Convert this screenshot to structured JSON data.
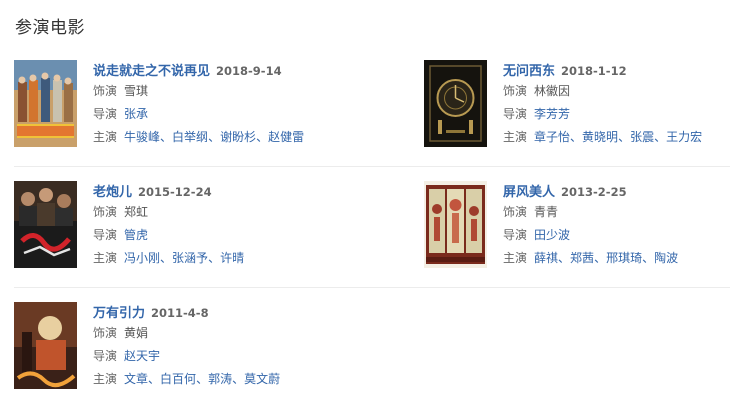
{
  "section_title": "参演电影",
  "labels": {
    "role": "饰演",
    "director": "导演",
    "cast": "主演",
    "separator": "、"
  },
  "movies": [
    {
      "title": "说走就走之不说再见",
      "date": "2018-9-14",
      "role": "雪琪",
      "director": "张承",
      "cast": [
        "牛骏峰",
        "白举纲",
        "谢盼杉",
        "赵健雷"
      ]
    },
    {
      "title": "无问西东",
      "date": "2018-1-12",
      "role": "林徽因",
      "director": "李芳芳",
      "cast": [
        "章子怡",
        "黄晓明",
        "张震",
        "王力宏"
      ]
    },
    {
      "title": "老炮儿",
      "date": "2015-12-24",
      "role": "郑虹",
      "director": "管虎",
      "cast": [
        "冯小刚",
        "张涵予",
        "许晴"
      ]
    },
    {
      "title": "屏风美人",
      "date": "2013-2-25",
      "role": "青青",
      "director": "田少波",
      "cast": [
        "薛祺",
        "郑茜",
        "邢琪琦",
        "陶波"
      ]
    },
    {
      "title": "万有引力",
      "date": "2011-4-8",
      "role": "黄娟",
      "director": "赵天宇",
      "cast": [
        "文章",
        "白百何",
        "郭涛",
        "莫文蔚"
      ]
    }
  ],
  "poster_colors": {
    "movie0": [
      "#a9865a",
      "#d2742e",
      "#3e5a7c"
    ],
    "movie1": [
      "#15130e",
      "#b89a52",
      "#2a2418"
    ],
    "movie2": [
      "#1b1b1b",
      "#b3202a",
      "#6b4f3a"
    ],
    "movie3": [
      "#7a2a1c",
      "#d9cfa8",
      "#9d3b2a"
    ],
    "movie4": [
      "#3a2118",
      "#c0542c",
      "#e8cfa0"
    ]
  }
}
